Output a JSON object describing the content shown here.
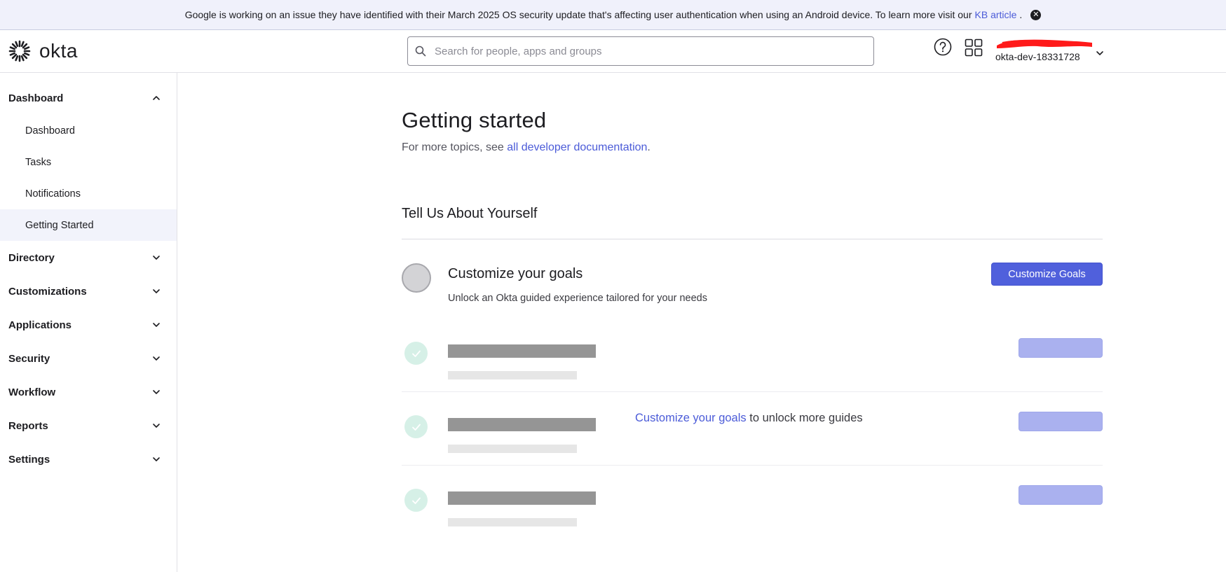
{
  "banner": {
    "message": "Google is working on an issue they have identified with their March 2025 OS security update that's affecting user authentication when using an Android device. To learn more visit our",
    "link_text": "KB article",
    "suffix": ".",
    "close_icon": "close-circle-icon"
  },
  "header": {
    "logo_text": "okta",
    "search_placeholder": "Search for people, apps and groups",
    "search_value": "",
    "account_org": "okta-dev-18331728"
  },
  "sidebar": {
    "sections": [
      {
        "label": "Dashboard",
        "expanded": true,
        "items": [
          "Dashboard",
          "Tasks",
          "Notifications",
          "Getting Started"
        ],
        "active_item": "Getting Started"
      },
      {
        "label": "Directory",
        "expanded": false
      },
      {
        "label": "Customizations",
        "expanded": false
      },
      {
        "label": "Applications",
        "expanded": false
      },
      {
        "label": "Security",
        "expanded": false
      },
      {
        "label": "Workflow",
        "expanded": false
      },
      {
        "label": "Reports",
        "expanded": false
      },
      {
        "label": "Settings",
        "expanded": false
      }
    ]
  },
  "main": {
    "title": "Getting started",
    "subtitle_prefix": "For more topics, see ",
    "subtitle_link": "all developer documentation",
    "subtitle_suffix": ".",
    "section_title": "Tell Us About Yourself",
    "goal": {
      "title": "Customize your goals",
      "description": "Unlock an Okta guided experience tailored for your needs",
      "button_label": "Customize Goals"
    },
    "unlock": {
      "link": "Customize your goals",
      "suffix": " to unlock more guides"
    }
  },
  "colors": {
    "accent": "#5060dc",
    "link": "#4b5bd8",
    "banner_bg": "#f0f1fb",
    "active_nav_bg": "#f2f3fb",
    "placeholder_dark": "#959595",
    "placeholder_light": "#e6e6e6",
    "placeholder_pill": "#aab1ef",
    "check_bg": "#d6f0e7"
  }
}
